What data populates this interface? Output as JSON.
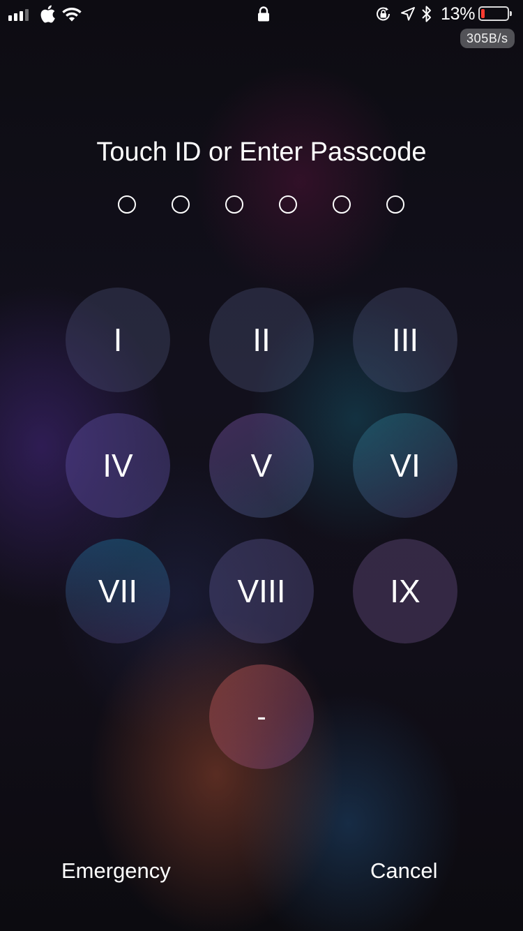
{
  "status_bar": {
    "signal_icon": "signal-bars-icon",
    "carrier_icon": "apple-icon",
    "wifi_icon": "wifi-icon",
    "lock_icon": "lock-icon",
    "rotation_lock_icon": "rotation-lock-icon",
    "location_icon": "location-arrow-icon",
    "bluetooth_icon": "bluetooth-icon",
    "battery_percent": "13%",
    "battery_level": 0.13,
    "battery_color": "#ff3b30",
    "net_speed": "305B/s"
  },
  "passcode": {
    "title": "Touch ID or Enter Passcode",
    "dot_count": 6,
    "entered": 0
  },
  "keypad": {
    "keys": [
      "I",
      "II",
      "III",
      "IV",
      "V",
      "VI",
      "VII",
      "VIII",
      "IX",
      "-"
    ]
  },
  "actions": {
    "emergency_label": "Emergency",
    "cancel_label": "Cancel"
  }
}
